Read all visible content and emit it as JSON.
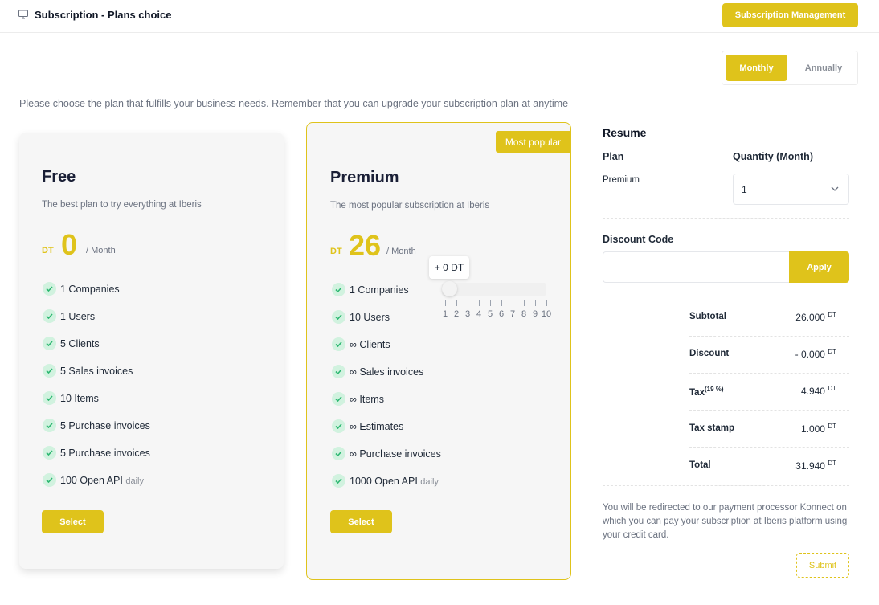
{
  "header": {
    "title": "Subscription - Plans choice",
    "management_button": "Subscription Management"
  },
  "billing_toggle": {
    "monthly": "Monthly",
    "annually": "Annually",
    "selected": "Monthly"
  },
  "intro": "Please choose the plan that fulfills your business needs. Remember that you can upgrade your subscription plan at anytime",
  "plans": [
    {
      "name": "Free",
      "description": "The best plan to try everything at Iberis",
      "currency": "DT",
      "price": "0",
      "period": "/ Month",
      "features": [
        {
          "text": "1 Companies"
        },
        {
          "text": "1 Users"
        },
        {
          "text": "5 Clients"
        },
        {
          "text": "5 Sales invoices"
        },
        {
          "text": "10 Items"
        },
        {
          "text": "5 Purchase invoices"
        },
        {
          "text": "5 Purchase invoices"
        },
        {
          "text": "100 Open API",
          "suffix": "daily"
        }
      ],
      "select_label": "Select"
    },
    {
      "name": "Premium",
      "badge": "Most popular",
      "description": "The most popular subscription at Iberis",
      "currency": "DT",
      "price": "26",
      "period": "/ Month",
      "features": [
        {
          "text": "1 Companies"
        },
        {
          "text": "10 Users"
        },
        {
          "text": "∞ Clients"
        },
        {
          "text": "∞ Sales invoices"
        },
        {
          "text": "∞ Items"
        },
        {
          "text": "∞ Estimates"
        },
        {
          "text": "∞ Purchase invoices"
        },
        {
          "text": "1000 Open API",
          "suffix": "daily"
        }
      ],
      "select_label": "Select",
      "users_slider": {
        "tooltip": "+ 0 DT",
        "ticks": [
          "1",
          "2",
          "3",
          "4",
          "5",
          "6",
          "7",
          "8",
          "9",
          "10"
        ],
        "value": 1
      }
    }
  ],
  "resume": {
    "title": "Resume",
    "plan_label": "Plan",
    "plan_value": "Premium",
    "quantity_label": "Quantity (Month)",
    "quantity_value": "1",
    "discount_label": "Discount Code",
    "discount_value": "",
    "apply_label": "Apply",
    "rows": [
      {
        "label": "Subtotal",
        "value": "26.000",
        "unit": "DT"
      },
      {
        "label": "Discount",
        "value": "- 0.000",
        "unit": "DT"
      },
      {
        "label": "Tax",
        "label_sup": "(19 %)",
        "value": "4.940",
        "unit": "DT"
      },
      {
        "label": "Tax stamp",
        "value": "1.000",
        "unit": "DT"
      },
      {
        "label": "Total",
        "value": "31.940",
        "unit": "DT"
      }
    ],
    "note": "You will be redirected to our payment processor Konnect on which you can pay your subscription at Iberis platform using your credit card.",
    "submit_label": "Submit"
  },
  "colors": {
    "accent": "#dfc31b",
    "check_bg": "#d1f2df",
    "check_mark": "#2eb872"
  }
}
